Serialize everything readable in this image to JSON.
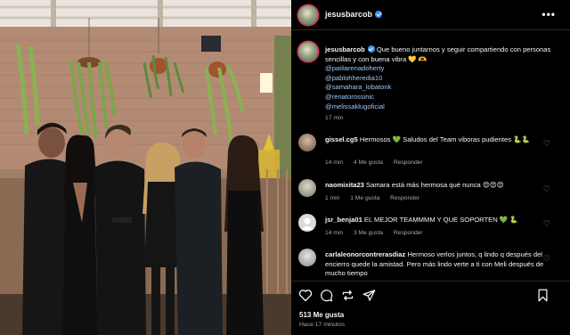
{
  "post": {
    "username": "jesusbarcob",
    "more_label": "•••",
    "caption_text": "Que bueno juntarnos y seguir compartiendo con personas sencillas y con buena vibra 💛 🫶",
    "mentions": [
      "@patilarenadoherty",
      "@pablohheredia10",
      "@samahara_lobatonk",
      "@renatorossinic",
      "@melissaklugoficial"
    ],
    "caption_time": "17 min",
    "likes": "513 Me gusta",
    "time_ago": "Hace 17 minutos"
  },
  "comments": [
    {
      "username": "gissel.cg5",
      "text": "Hermosos 💚 Saludos del Team viboras pudientes 🐍🐍",
      "time": "14 min",
      "likes": "4 Me gusta",
      "reply": "Responder"
    },
    {
      "username": "naomixita23",
      "text": "Samara está más hermosa qué nunca 😍😍😍",
      "time": "1 min",
      "likes": "1 Me gusta",
      "reply": "Responder"
    },
    {
      "username": "jsr_benja01",
      "text": "EL MEJOR TEAMMMM Y QUE SOPORTEN 💚 🐍",
      "time": "14 min",
      "likes": "3 Me gusta",
      "reply": "Responder"
    },
    {
      "username": "carlaleonorcontrerasdiaz",
      "text": "Hermoso verlos juntos, q lindo q después del encierro quede la amistad. Pero más lindo verte a ti con Meli después de mucho tiempo",
      "time": "",
      "likes": "",
      "reply": ""
    }
  ],
  "icons": {
    "like": "heart-icon",
    "comment": "comment-icon",
    "share": "repost-icon",
    "send": "send-icon",
    "save": "bookmark-icon"
  },
  "colors": {
    "background": "#000000",
    "verified": "#3897f0",
    "mention": "#a0c8f0",
    "muted": "#a8a8a8"
  }
}
